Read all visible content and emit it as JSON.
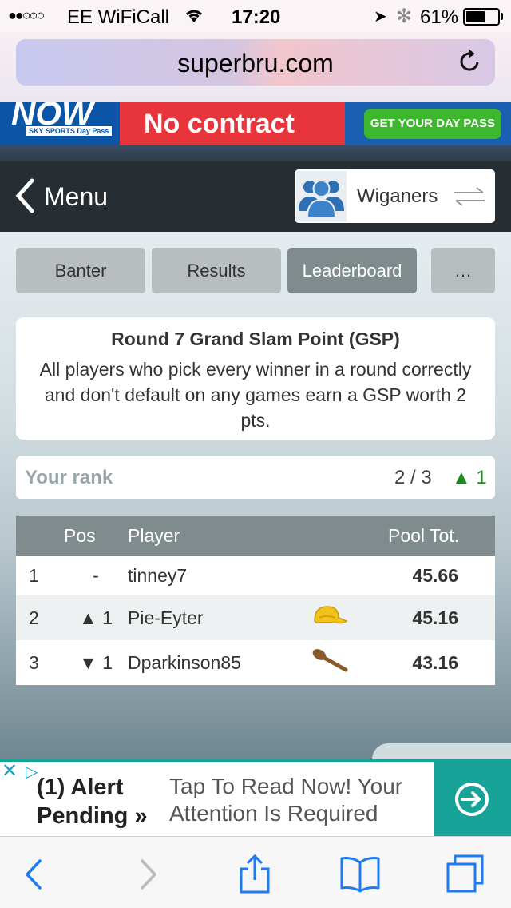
{
  "status_bar": {
    "signal": "●●○○○",
    "carrier": "EE WiFiCall",
    "time": "17:20",
    "battery_pct": "61%",
    "battery_level": 0.61
  },
  "browser": {
    "url": "superbru.com"
  },
  "top_ad": {
    "brand": "NOW",
    "brand_sub": "SKY SPORTS Day Pass",
    "headline": "No contract",
    "cta": "GET YOUR DAY PASS"
  },
  "header": {
    "back_label": "Menu",
    "group_name": "Wiganers"
  },
  "tabs": [
    {
      "label": "Banter",
      "active": false
    },
    {
      "label": "Results",
      "active": false
    },
    {
      "label": "Leaderboard",
      "active": true
    },
    {
      "label": "…",
      "active": false
    }
  ],
  "gsp": {
    "title": "Round 7 Grand Slam Point (GSP)",
    "body": "All players who pick every winner in a round correctly and don't default on any games earn a GSP worth 2 pts."
  },
  "rank": {
    "label": "Your rank",
    "value": "2 / 3",
    "change": "▲ 1"
  },
  "leaderboard": {
    "headers": {
      "pos": "Pos",
      "player": "Player",
      "total": "Pool Tot."
    },
    "rows": [
      {
        "rank": "1",
        "move": "-",
        "move_dir": "none",
        "player": "tinney7",
        "badge": "",
        "total": "45.66"
      },
      {
        "rank": "2",
        "move": "▲ 1",
        "move_dir": "up",
        "player": "Pie-Eyter",
        "badge": "cap-icon",
        "total": "45.16"
      },
      {
        "rank": "3",
        "move": "▼ 1",
        "move_dir": "down",
        "player": "Dparkinson85",
        "badge": "wooden-spoon-icon",
        "total": "43.16"
      }
    ]
  },
  "bottom_ad": {
    "alert": "(1) Alert Pending »",
    "message": "Tap To Read Now! Your Attention Is Required"
  },
  "colors": {
    "header_bg": "#262d33",
    "tab_active": "#7f8b8d",
    "link": "#2f8fc7",
    "up": "#1d8a1d",
    "down": "#d62424",
    "ad_accent": "#17a398"
  }
}
